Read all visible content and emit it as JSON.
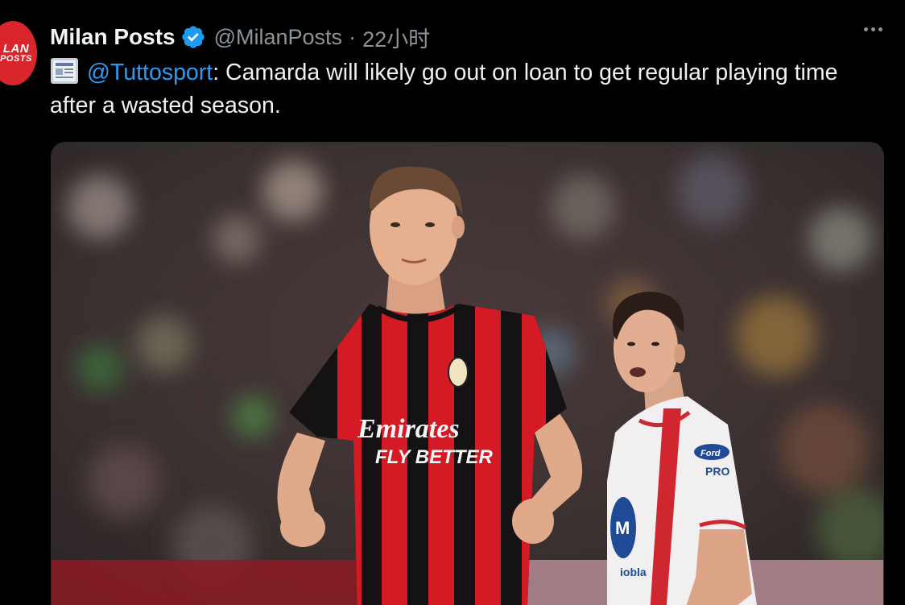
{
  "author": {
    "avatar_text_top": "LAN",
    "avatar_text_bottom": "POSTS",
    "display_name": "Milan Posts",
    "handle": "@MilanPosts",
    "separator": "·",
    "time": "22小时"
  },
  "tweet": {
    "mention": "@Tuttosport",
    "body": ": Camarda will likely go out on loan to get regular playing time after a wasted season."
  },
  "media": {
    "sponsor_line1": "Emirates",
    "sponsor_line2": "FLY BETTER",
    "opponent_sponsor_top": "Ford",
    "opponent_sponsor_bottom": "PRO",
    "opponent_chest_logo": "M",
    "opponent_chest_text": "iobla"
  },
  "icons": {
    "verified": "verified-badge-icon",
    "more": "more-options-icon",
    "news": "newspaper-icon"
  },
  "colors": {
    "verified": "#1d9bf0",
    "mention": "#2f9bf0",
    "avatar": "#d8262c",
    "milan_red": "#d41a24"
  }
}
